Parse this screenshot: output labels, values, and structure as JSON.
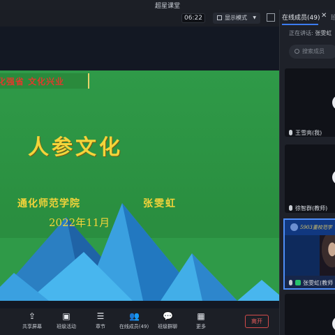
{
  "window": {
    "title": "超星课堂"
  },
  "toolbar": {
    "timer": "06:22",
    "display_mode_label": "显示模式"
  },
  "slide": {
    "banner": "化强省 文化兴业",
    "title": "人参文化",
    "organization": "通化师范学院",
    "author": "张雯虹",
    "date": "2022年11月"
  },
  "bottom_bar": {
    "items": [
      {
        "label": "共享屏幕",
        "icon": "share-screen-icon"
      },
      {
        "label": "班级活动",
        "icon": "class-activity-icon"
      },
      {
        "label": "章节",
        "icon": "chapter-icon"
      },
      {
        "label": "在线成员(49)",
        "icon": "members-icon"
      },
      {
        "label": "班级群聊",
        "icon": "group-chat-icon"
      },
      {
        "label": "更多",
        "icon": "more-grid-icon"
      }
    ],
    "leave_label": "离开"
  },
  "panel": {
    "tab_label": "在线成员(49)",
    "second_tab_label": "班",
    "speaking_prefix": "正在讲话:",
    "speaking_name": "张雯虹",
    "search_placeholder": "搜索成员",
    "members": [
      {
        "name": "王雪亮(我)"
      },
      {
        "name": "徐智群(教师)"
      },
      {
        "name": "张雯虹(教师"
      }
    ],
    "video_overlay_text": "5903重校范学"
  },
  "colors": {
    "accent": "#3c7cf0",
    "slide_green": "#2f9a48",
    "title_yellow": "#f4d43a",
    "leave_red": "#e25b5b"
  }
}
